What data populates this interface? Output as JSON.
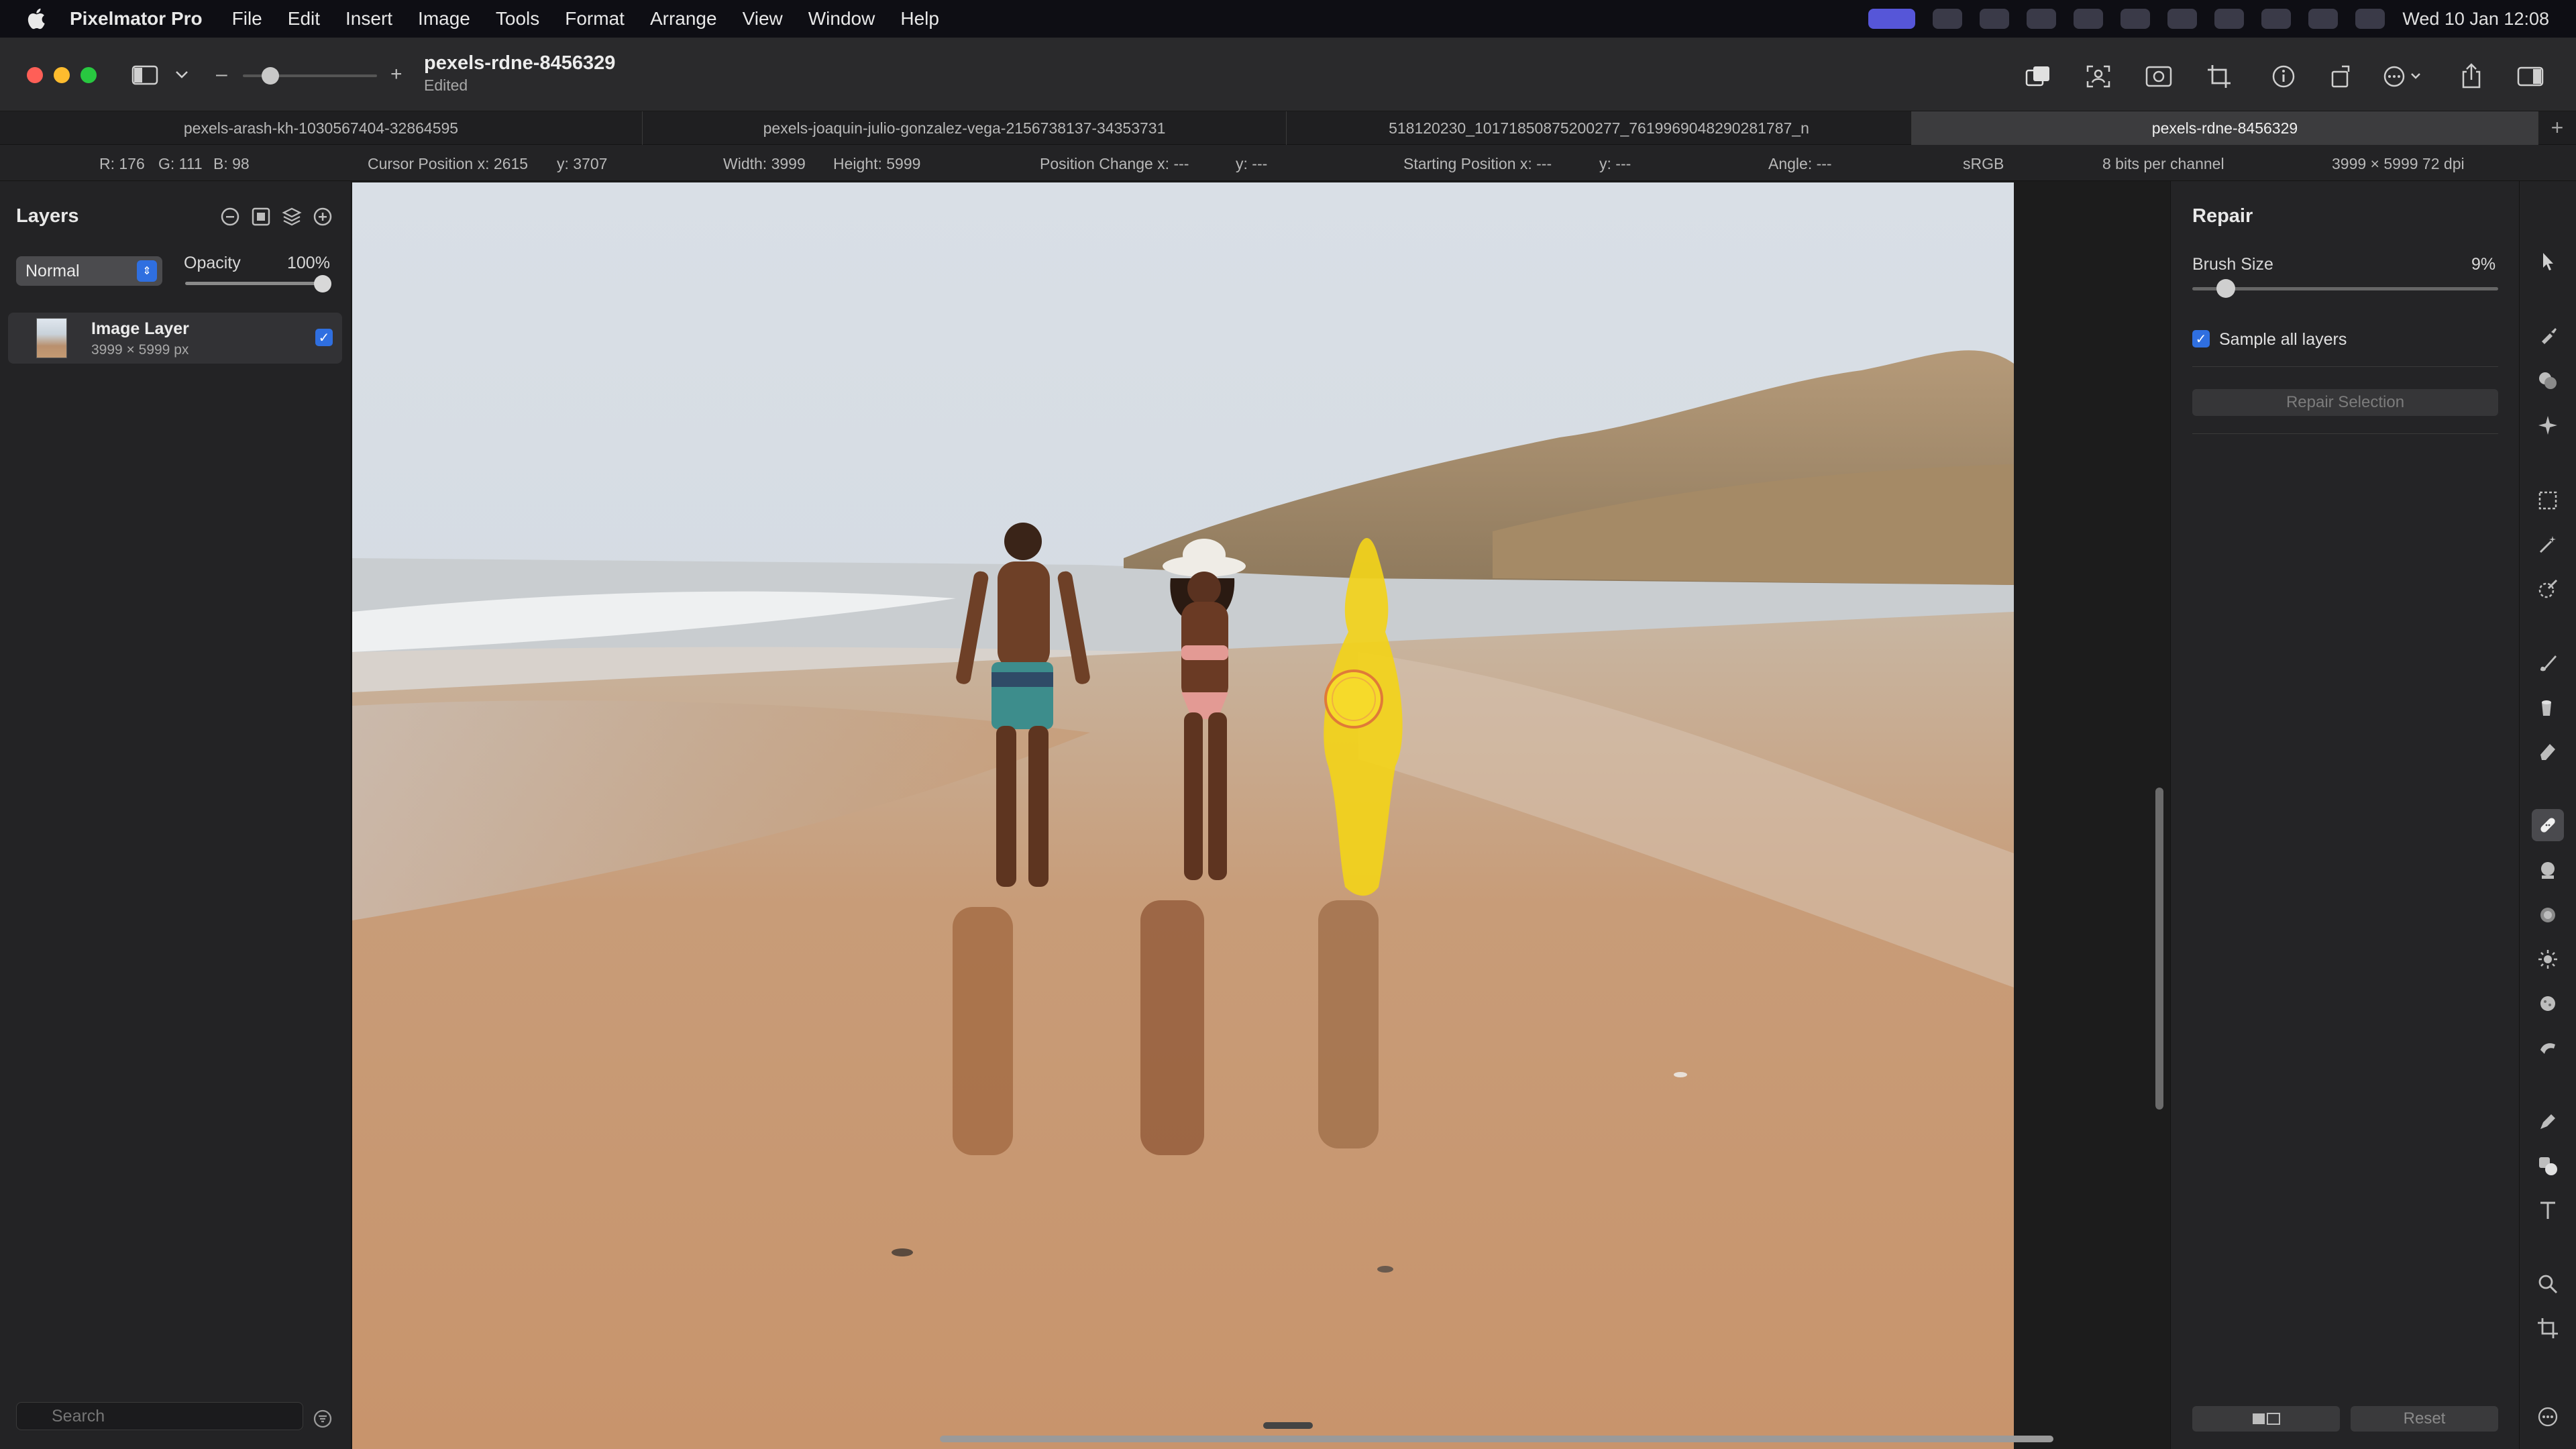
{
  "menubar": {
    "app_name": "Pixelmator Pro",
    "items": [
      "File",
      "Edit",
      "Insert",
      "Image",
      "Tools",
      "Format",
      "Arrange",
      "View",
      "Window",
      "Help"
    ],
    "clock": "Wed 10 Jan 12:08"
  },
  "toolbar": {
    "doc_title": "pexels-rdne-8456329",
    "doc_status": "Edited",
    "zoom_minus": "–",
    "zoom_plus": "+"
  },
  "tabs": [
    {
      "label": "pexels-arash-kh-1030567404-32864595",
      "active": false
    },
    {
      "label": "pexels-joaquin-julio-gonzalez-vega-2156738137-34353731",
      "active": false
    },
    {
      "label": "518120230_10171850875200277_7619969048290281787_n",
      "active": false
    },
    {
      "label": "pexels-rdne-8456329",
      "active": true
    }
  ],
  "tab_add": "+",
  "infobar": {
    "r": "R: 176",
    "g": "G: 111",
    "b": "B: 98",
    "cursor_x": "Cursor Position x: 2615",
    "cursor_y": "y: 3707",
    "width": "Width: 3999",
    "height": "Height: 5999",
    "pos_change_x": "Position Change x: ---",
    "pos_change_y": "y: ---",
    "start_x": "Starting Position x: ---",
    "start_y": "y: ---",
    "angle": "Angle: ---",
    "colorspace": "sRGB",
    "bits": "8 bits per channel",
    "dims": "3999 × 5999 72 dpi"
  },
  "layers": {
    "title": "Layers",
    "blend_mode": "Normal",
    "opacity_label": "Opacity",
    "opacity_value": "100%",
    "opacity_level": 1.0,
    "items": [
      {
        "name": "Image Layer",
        "size": "3999 × 5999 px",
        "visible": true
      }
    ],
    "search_placeholder": "Search"
  },
  "repair": {
    "title": "Repair",
    "brush_size_label": "Brush Size",
    "brush_size_value": "9%",
    "brush_size_level": 0.09,
    "sample_all_label": "Sample all layers",
    "sample_all_checked": true,
    "repair_selection_label": "Repair Selection",
    "reset_label": "Reset"
  },
  "colors": {
    "accent": "#2f6fe0",
    "mask": "#f2d21a"
  }
}
